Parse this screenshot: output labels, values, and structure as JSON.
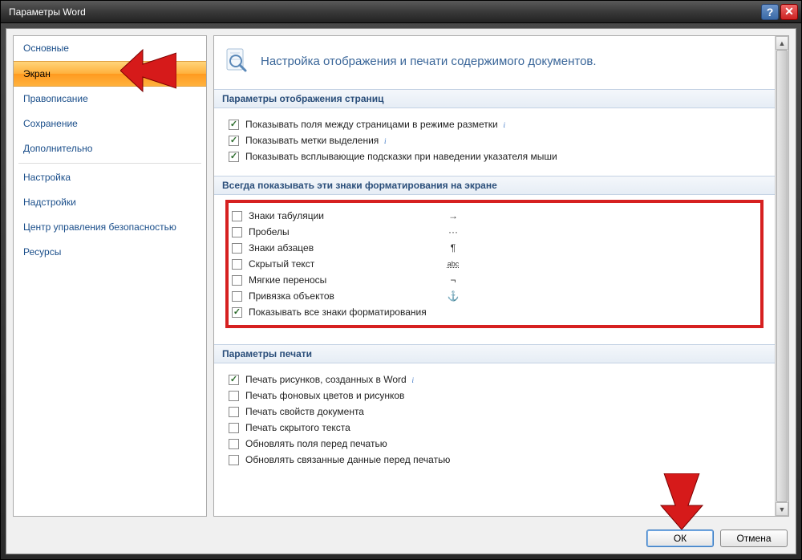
{
  "title": "Параметры Word",
  "sidebar": {
    "items": [
      {
        "label": "Основные"
      },
      {
        "label": "Экран"
      },
      {
        "label": "Правописание"
      },
      {
        "label": "Сохранение"
      },
      {
        "label": "Дополнительно"
      },
      {
        "label": "Настройка"
      },
      {
        "label": "Надстройки"
      },
      {
        "label": "Центр управления безопасностью"
      },
      {
        "label": "Ресурсы"
      }
    ],
    "selected_index": 1
  },
  "header": {
    "description": "Настройка отображения и печати содержимого документов."
  },
  "sections": {
    "page_display": {
      "title": "Параметры отображения страниц",
      "options": [
        {
          "label": "Показывать поля между страницами в режиме разметки",
          "checked": true,
          "info": true
        },
        {
          "label": "Показывать метки выделения",
          "checked": true,
          "info": true
        },
        {
          "label": "Показывать всплывающие подсказки при наведении указателя мыши",
          "checked": true,
          "info": false
        }
      ]
    },
    "formatting_marks": {
      "title": "Всегда показывать эти знаки форматирования на экране",
      "options": [
        {
          "label": "Знаки табуляции",
          "checked": false,
          "symbol": "→"
        },
        {
          "label": "Пробелы",
          "checked": false,
          "symbol": "···"
        },
        {
          "label": "Знаки абзацев",
          "checked": false,
          "symbol": "¶"
        },
        {
          "label": "Скрытый текст",
          "checked": false,
          "symbol": "abc"
        },
        {
          "label": "Мягкие переносы",
          "checked": false,
          "symbol": "¬"
        },
        {
          "label": "Привязка объектов",
          "checked": false,
          "symbol": "⚓"
        },
        {
          "label": "Показывать все знаки форматирования",
          "checked": true,
          "symbol": ""
        }
      ]
    },
    "printing": {
      "title": "Параметры печати",
      "options": [
        {
          "label": "Печать рисунков, созданных в Word",
          "checked": true,
          "info": true
        },
        {
          "label": "Печать фоновых цветов и рисунков",
          "checked": false,
          "info": false
        },
        {
          "label": "Печать свойств документа",
          "checked": false,
          "info": false
        },
        {
          "label": "Печать скрытого текста",
          "checked": false,
          "info": false
        },
        {
          "label": "Обновлять поля перед печатью",
          "checked": false,
          "info": false
        },
        {
          "label": "Обновлять связанные данные перед печатью",
          "checked": false,
          "info": false
        }
      ]
    }
  },
  "buttons": {
    "ok": "ОК",
    "cancel": "Отмена"
  }
}
